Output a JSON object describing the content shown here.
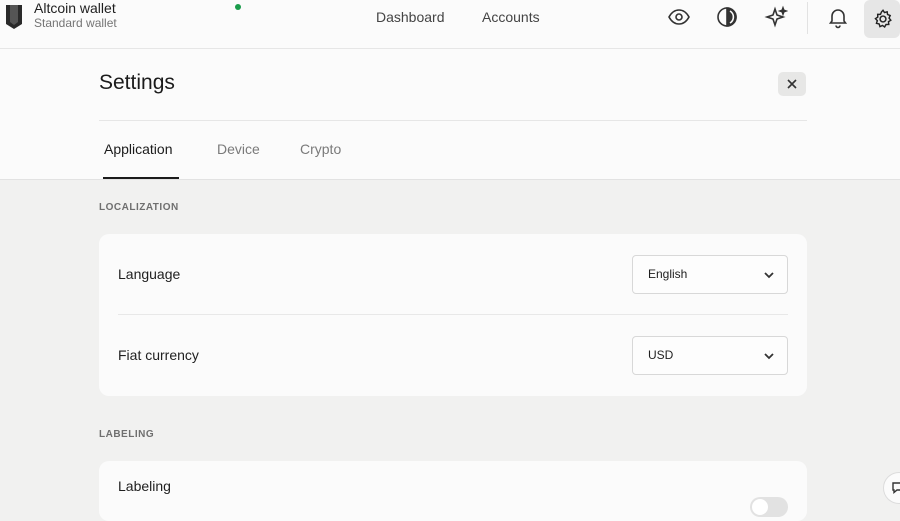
{
  "wallet": {
    "name": "Altcoin wallet",
    "type": "Standard wallet",
    "status_color": "#1a9c4b"
  },
  "nav": {
    "dashboard": "Dashboard",
    "accounts": "Accounts"
  },
  "toolbar_icons": [
    "eye-icon",
    "discreet-mode-icon",
    "sparkle-icon",
    "bell-icon",
    "gear-icon"
  ],
  "settings": {
    "title": "Settings",
    "tabs": [
      {
        "label": "Application",
        "active": true
      },
      {
        "label": "Device",
        "active": false
      },
      {
        "label": "Crypto",
        "active": false
      }
    ],
    "sections": {
      "localization": {
        "title": "LOCALIZATION",
        "language": {
          "label": "Language",
          "value": "English"
        },
        "fiat": {
          "label": "Fiat currency",
          "value": "USD"
        }
      },
      "labeling": {
        "title": "LABELING",
        "label": "Labeling",
        "enabled": false
      }
    }
  },
  "colors": {
    "background": "#f1f1f0",
    "card": "#fbfbfb",
    "active_tab": "#1b1b1b"
  }
}
